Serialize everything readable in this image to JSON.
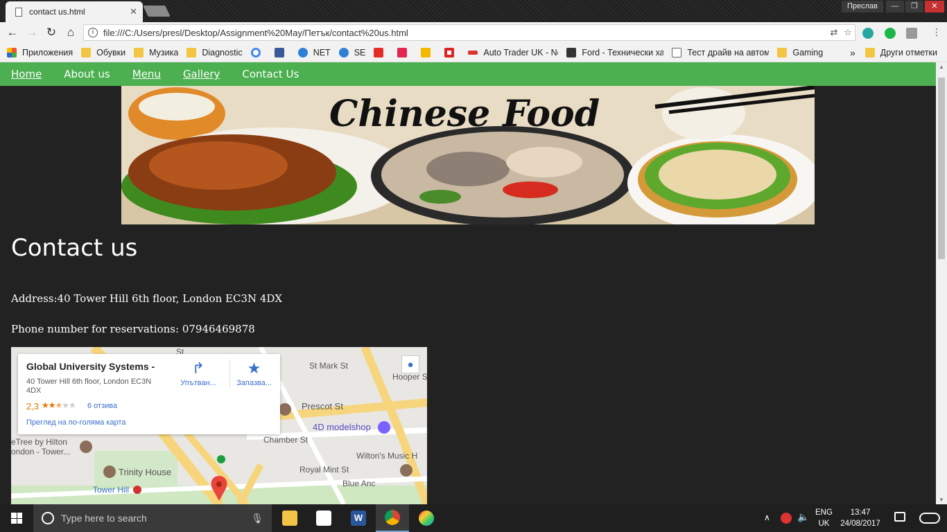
{
  "browser": {
    "tab_title": "contact us.html",
    "tab_close": "✕",
    "user_name": "Преслав",
    "url": "file:///C:/Users/presl/Desktop/Assignment%20May/Петък/contact%20us.html",
    "bookmarks": [
      {
        "label": "Приложения",
        "icon": "apps-grid-icon"
      },
      {
        "label": "Обувки",
        "icon": "folder-icon"
      },
      {
        "label": "Музика",
        "icon": "folder-icon"
      },
      {
        "label": "Diagnostic",
        "icon": "folder-icon"
      },
      {
        "label": "",
        "icon": "google-icon"
      },
      {
        "label": "",
        "icon": "facebook-icon"
      },
      {
        "label": "NET",
        "icon": "globe-icon"
      },
      {
        "label": "SE",
        "icon": "globe-icon"
      },
      {
        "label": "",
        "icon": "youtube-icon"
      },
      {
        "label": "",
        "icon": "seven-icon"
      },
      {
        "label": "",
        "icon": "grid-icon"
      },
      {
        "label": "",
        "icon": "red-cross-icon"
      },
      {
        "label": "Auto Trader UK - Nev",
        "icon": "autotrader-icon"
      },
      {
        "label": "Ford - Технически ха",
        "icon": "ford-icon"
      },
      {
        "label": "Тест драйв на автом",
        "icon": "page-icon"
      },
      {
        "label": "Gaming",
        "icon": "folder-icon"
      }
    ],
    "bookmarks_more": "»",
    "other_bookmarks": "Други отметки"
  },
  "site": {
    "nav": [
      "Home",
      "About us",
      "Menu",
      "Gallery",
      "Contact Us"
    ],
    "banner_title": "Chinese Food",
    "heading": "Contact us",
    "address": "Address:40 Tower Hill 6th floor, London EC3N 4DX",
    "phone": "Phone number for reservations: 07946469878"
  },
  "map": {
    "place_name": "Global University Systems -",
    "place_address": "40 Tower Hill 6th floor, London EC3N 4DX",
    "rating": "2,3",
    "rating_value": 2.3,
    "reviews": "6 отзива",
    "larger_map": "Преглед на по-голяма карта",
    "directions": "Упътван...",
    "save": "Запазва...",
    "labels": {
      "prescot": "Prescot St",
      "modelshop": "4D modelshop",
      "chamber": "Chamber St",
      "wiltons": "Wilton's Music H",
      "royal_mint": "Royal Mint St",
      "hilton": "eTree by Hilton",
      "london_tower": "ondon - Tower...",
      "trinity": "Trinity House",
      "tower_hill": "Tower Hill",
      "mansell": "St Mark St",
      "hooper": "Hooper S",
      "st": "St",
      "blue_anchor": "Blue Anc"
    }
  },
  "taskbar": {
    "search_placeholder": "Type here to search",
    "lang_top": "ENG",
    "lang_bottom": "UK",
    "time": "13:47",
    "date": "24/08/2017"
  }
}
